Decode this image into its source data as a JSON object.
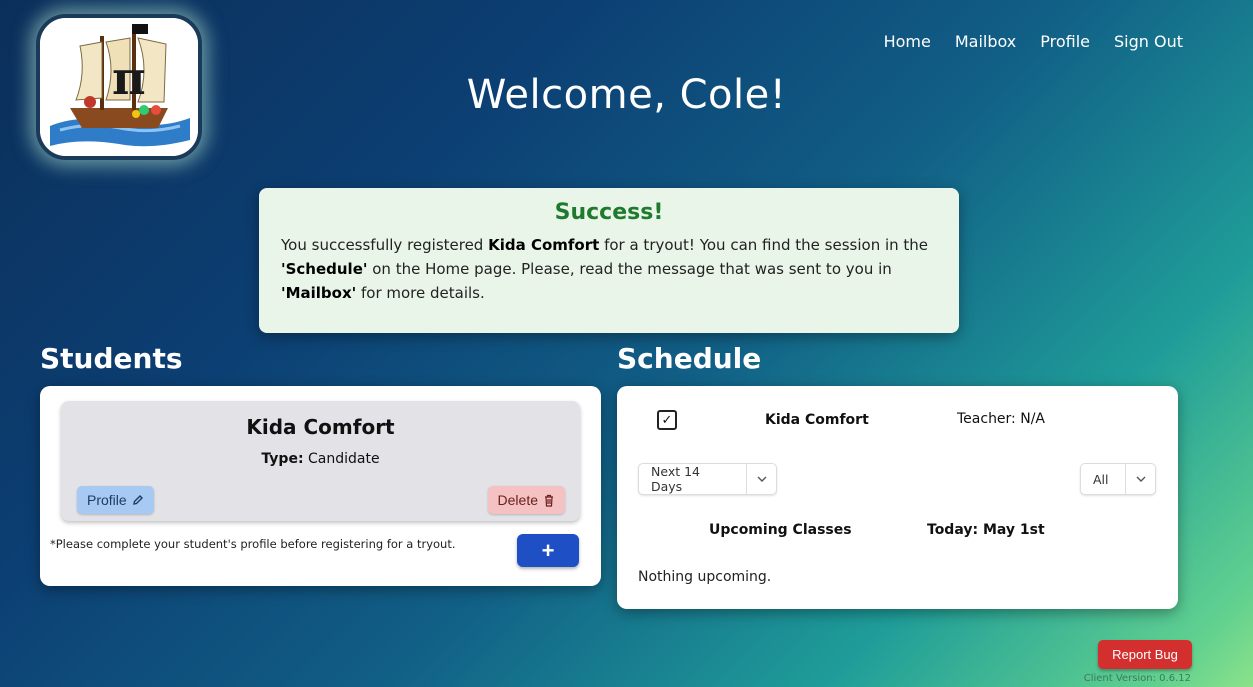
{
  "nav": {
    "items": [
      "Home",
      "Mailbox",
      "Profile",
      "Sign Out"
    ]
  },
  "header": {
    "welcome": "Welcome, Cole!"
  },
  "alert": {
    "title": "Success!",
    "body_1": "You successfully registered ",
    "student_name": "Kida Comfort",
    "body_2": " for a tryout! You can find the session in the ",
    "schedule_word": "'Schedule'",
    "body_3": " on the Home page. Please, read the message that was sent to you in ",
    "mailbox_word": "'Mailbox'",
    "body_4": " for more details."
  },
  "students": {
    "title": "Students",
    "card": {
      "name": "Kida Comfort",
      "type_label": "Type:",
      "type_value": "Candidate",
      "profile_button": "Profile",
      "delete_button": "Delete"
    },
    "note": "*Please complete your student's profile before registering for a tryout.",
    "add_button": "+"
  },
  "schedule": {
    "title": "Schedule",
    "checkbox_mark": "✓",
    "student_name": "Kida Comfort",
    "teacher": "Teacher: N/A",
    "range_filter": "Next 14 Days",
    "type_filter": "All",
    "upcoming_label": "Upcoming Classes",
    "today_label": "Today: May 1st",
    "empty_text": "Nothing upcoming."
  },
  "footer": {
    "report_bug": "Report Bug",
    "version": "Client Version: 0.6.12"
  }
}
